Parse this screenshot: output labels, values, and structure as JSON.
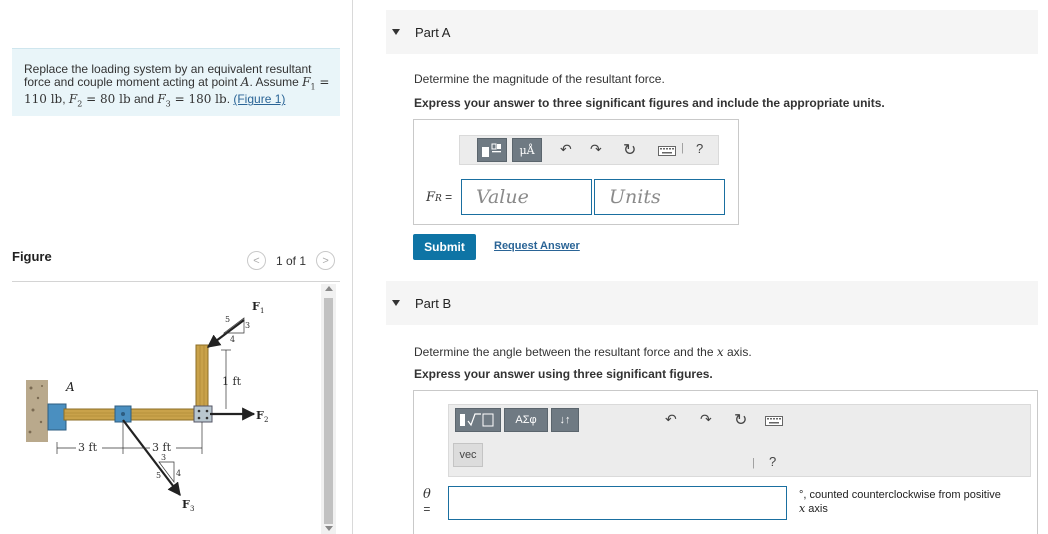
{
  "problem": {
    "text_prefix": "Replace the loading system by an equivalent resultant force and couple moment acting at point ",
    "point": "A",
    "text_assume": ". Assume ",
    "f1_sym": "F",
    "f1_sub": "1",
    "f1_val": " = 110 lb",
    "f2_sym": "F",
    "f2_sub": "2",
    "f2_val": " = 80 lb",
    "and_text": " and ",
    "f3_sym": "F",
    "f3_sub": "3",
    "f3_val": " = 180 lb",
    "figure_link": "(Figure 1)"
  },
  "figure": {
    "label": "Figure",
    "pager": "1 of 1",
    "prev_glyph": "<",
    "next_glyph": ">",
    "labels": {
      "A": "A",
      "F1": "F",
      "F1_sub": "1",
      "F2": "F",
      "F2_sub": "2",
      "F3": "F",
      "F3_sub": "3",
      "one_ft": "1 ft",
      "three_ft_a": "3 ft",
      "three_ft_b": "3 ft",
      "tri1_5": "5",
      "tri1_3": "3",
      "tri1_4": "4",
      "tri3_5": "5",
      "tri3_3": "3",
      "tri3_4": "4"
    },
    "colors": {
      "wood": "#c9a24a",
      "bracket": "#4a8fc0",
      "arrow": "#222222"
    }
  },
  "partA": {
    "title": "Part A",
    "question": "Determine the magnitude of the resultant force.",
    "instruction": "Express your answer to three significant figures and include the appropriate units.",
    "templates_icon": "templates-icon",
    "mu_label": "μÅ",
    "help_glyph": "?",
    "var_sym": "F",
    "var_sub": "R",
    "equals": " =",
    "value_placeholder": "Value",
    "units_placeholder": "Units",
    "submit": "Submit",
    "request_answer": "Request Answer"
  },
  "partB": {
    "title": "Part B",
    "question_prefix": "Determine the angle between the resultant force and the ",
    "axis_var": "x",
    "question_suffix": " axis.",
    "instruction": "Express your answer using three significant figures.",
    "greek_label": "ΑΣφ",
    "arrows_label": "↓↑",
    "vec_label": "vec",
    "help_glyph": "?",
    "var_sym": "θ",
    "equals": "=",
    "unit_suffix_prefix": "°, counted counterclockwise from positive",
    "unit_suffix_var": "x",
    "unit_suffix_end": " axis"
  }
}
